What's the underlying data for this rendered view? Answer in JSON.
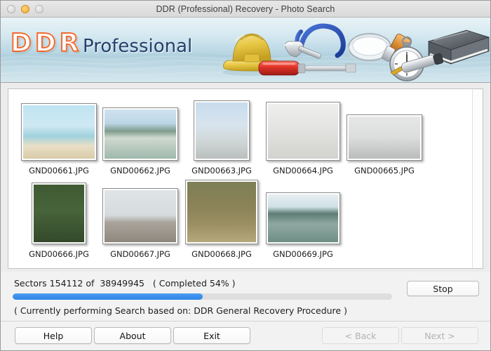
{
  "window": {
    "title": "DDR (Professional) Recovery - Photo Search",
    "close_label": "",
    "minimize_label": "",
    "maximize_label": ""
  },
  "banner": {
    "logo_primary": "DDR",
    "logo_secondary": "Professional",
    "logo_color": "#ef6a31",
    "secondary_color": "#24416b",
    "icons": [
      "hard-hat-icon",
      "pliers-icon",
      "hammer-icon",
      "magnifier-icon",
      "orange-screwdriver-icon",
      "red-screwdriver-icon",
      "stopwatch-icon",
      "book-icon",
      "pen-icon"
    ]
  },
  "files": {
    "rows": [
      [
        {
          "name": "GND00661.JPG",
          "w": 102,
          "h": 76,
          "scene": "beach-swing"
        },
        {
          "name": "GND00662.JPG",
          "w": 102,
          "h": 70,
          "scene": "red-kayak"
        },
        {
          "name": "GND00663.JPG",
          "w": 74,
          "h": 80,
          "scene": "girl-portrait"
        },
        {
          "name": "GND00664.JPG",
          "w": 100,
          "h": 78,
          "scene": "couple-street"
        },
        {
          "name": "GND00665.JPG",
          "w": 102,
          "h": 60,
          "scene": "friends-sitting"
        }
      ],
      [
        {
          "name": "GND00666.JPG",
          "w": 72,
          "h": 82,
          "scene": "parent-child-garden"
        },
        {
          "name": "GND00667.JPG",
          "w": 102,
          "h": 74,
          "scene": "rooftop-jump"
        },
        {
          "name": "GND00668.JPG",
          "w": 98,
          "h": 86,
          "scene": "couple-autumn"
        },
        {
          "name": "GND00669.JPG",
          "w": 100,
          "h": 68,
          "scene": "yellow-kayak"
        }
      ]
    ]
  },
  "progress": {
    "sectors_text": "Sectors 154112 of  38949945   ( Completed 54% )",
    "sectors_current": "154112",
    "sectors_total": "38949945",
    "completed_percent": "54%",
    "bar_fill_percent": 50,
    "bar_color": "#2f86e8",
    "stop_label": "Stop",
    "current_operation": "( Currently performing Search based on: DDR General Recovery Procedure )"
  },
  "footer": {
    "help_label": "Help",
    "about_label": "About",
    "exit_label": "Exit",
    "back_label": "< Back",
    "next_label": "Next >"
  }
}
